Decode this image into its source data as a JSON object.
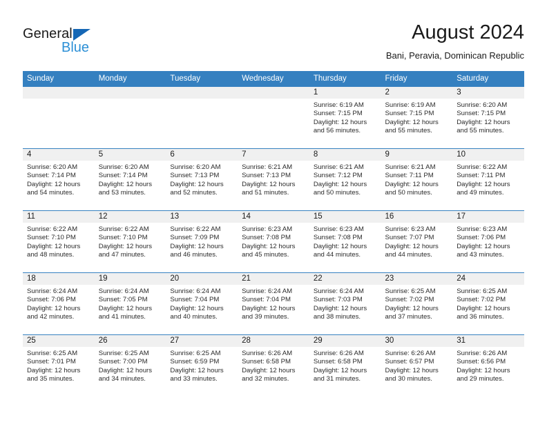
{
  "brand": {
    "name_part1": "General",
    "name_part2": "Blue",
    "triangle_color": "#1567b5",
    "blue_color": "#2b8fd6"
  },
  "header": {
    "title": "August 2024",
    "subtitle": "Bani, Peravia, Dominican Republic"
  },
  "theme": {
    "header_row_bg": "#3580c0",
    "daynum_bg": "#f0f0f0",
    "border_color": "#3580c0"
  },
  "weekday_headers": [
    "Sunday",
    "Monday",
    "Tuesday",
    "Wednesday",
    "Thursday",
    "Friday",
    "Saturday"
  ],
  "weeks": [
    [
      {
        "day": "",
        "empty": true,
        "sunrise": "",
        "sunset": "",
        "daylight_line1": "",
        "daylight_line2": ""
      },
      {
        "day": "",
        "empty": true,
        "sunrise": "",
        "sunset": "",
        "daylight_line1": "",
        "daylight_line2": ""
      },
      {
        "day": "",
        "empty": true,
        "sunrise": "",
        "sunset": "",
        "daylight_line1": "",
        "daylight_line2": ""
      },
      {
        "day": "",
        "empty": true,
        "sunrise": "",
        "sunset": "",
        "daylight_line1": "",
        "daylight_line2": ""
      },
      {
        "day": "1",
        "empty": false,
        "sunrise": "Sunrise: 6:19 AM",
        "sunset": "Sunset: 7:15 PM",
        "daylight_line1": "Daylight: 12 hours",
        "daylight_line2": "and 56 minutes."
      },
      {
        "day": "2",
        "empty": false,
        "sunrise": "Sunrise: 6:19 AM",
        "sunset": "Sunset: 7:15 PM",
        "daylight_line1": "Daylight: 12 hours",
        "daylight_line2": "and 55 minutes."
      },
      {
        "day": "3",
        "empty": false,
        "sunrise": "Sunrise: 6:20 AM",
        "sunset": "Sunset: 7:15 PM",
        "daylight_line1": "Daylight: 12 hours",
        "daylight_line2": "and 55 minutes."
      }
    ],
    [
      {
        "day": "4",
        "empty": false,
        "sunrise": "Sunrise: 6:20 AM",
        "sunset": "Sunset: 7:14 PM",
        "daylight_line1": "Daylight: 12 hours",
        "daylight_line2": "and 54 minutes."
      },
      {
        "day": "5",
        "empty": false,
        "sunrise": "Sunrise: 6:20 AM",
        "sunset": "Sunset: 7:14 PM",
        "daylight_line1": "Daylight: 12 hours",
        "daylight_line2": "and 53 minutes."
      },
      {
        "day": "6",
        "empty": false,
        "sunrise": "Sunrise: 6:20 AM",
        "sunset": "Sunset: 7:13 PM",
        "daylight_line1": "Daylight: 12 hours",
        "daylight_line2": "and 52 minutes."
      },
      {
        "day": "7",
        "empty": false,
        "sunrise": "Sunrise: 6:21 AM",
        "sunset": "Sunset: 7:13 PM",
        "daylight_line1": "Daylight: 12 hours",
        "daylight_line2": "and 51 minutes."
      },
      {
        "day": "8",
        "empty": false,
        "sunrise": "Sunrise: 6:21 AM",
        "sunset": "Sunset: 7:12 PM",
        "daylight_line1": "Daylight: 12 hours",
        "daylight_line2": "and 50 minutes."
      },
      {
        "day": "9",
        "empty": false,
        "sunrise": "Sunrise: 6:21 AM",
        "sunset": "Sunset: 7:11 PM",
        "daylight_line1": "Daylight: 12 hours",
        "daylight_line2": "and 50 minutes."
      },
      {
        "day": "10",
        "empty": false,
        "sunrise": "Sunrise: 6:22 AM",
        "sunset": "Sunset: 7:11 PM",
        "daylight_line1": "Daylight: 12 hours",
        "daylight_line2": "and 49 minutes."
      }
    ],
    [
      {
        "day": "11",
        "empty": false,
        "sunrise": "Sunrise: 6:22 AM",
        "sunset": "Sunset: 7:10 PM",
        "daylight_line1": "Daylight: 12 hours",
        "daylight_line2": "and 48 minutes."
      },
      {
        "day": "12",
        "empty": false,
        "sunrise": "Sunrise: 6:22 AM",
        "sunset": "Sunset: 7:10 PM",
        "daylight_line1": "Daylight: 12 hours",
        "daylight_line2": "and 47 minutes."
      },
      {
        "day": "13",
        "empty": false,
        "sunrise": "Sunrise: 6:22 AM",
        "sunset": "Sunset: 7:09 PM",
        "daylight_line1": "Daylight: 12 hours",
        "daylight_line2": "and 46 minutes."
      },
      {
        "day": "14",
        "empty": false,
        "sunrise": "Sunrise: 6:23 AM",
        "sunset": "Sunset: 7:08 PM",
        "daylight_line1": "Daylight: 12 hours",
        "daylight_line2": "and 45 minutes."
      },
      {
        "day": "15",
        "empty": false,
        "sunrise": "Sunrise: 6:23 AM",
        "sunset": "Sunset: 7:08 PM",
        "daylight_line1": "Daylight: 12 hours",
        "daylight_line2": "and 44 minutes."
      },
      {
        "day": "16",
        "empty": false,
        "sunrise": "Sunrise: 6:23 AM",
        "sunset": "Sunset: 7:07 PM",
        "daylight_line1": "Daylight: 12 hours",
        "daylight_line2": "and 44 minutes."
      },
      {
        "day": "17",
        "empty": false,
        "sunrise": "Sunrise: 6:23 AM",
        "sunset": "Sunset: 7:06 PM",
        "daylight_line1": "Daylight: 12 hours",
        "daylight_line2": "and 43 minutes."
      }
    ],
    [
      {
        "day": "18",
        "empty": false,
        "sunrise": "Sunrise: 6:24 AM",
        "sunset": "Sunset: 7:06 PM",
        "daylight_line1": "Daylight: 12 hours",
        "daylight_line2": "and 42 minutes."
      },
      {
        "day": "19",
        "empty": false,
        "sunrise": "Sunrise: 6:24 AM",
        "sunset": "Sunset: 7:05 PM",
        "daylight_line1": "Daylight: 12 hours",
        "daylight_line2": "and 41 minutes."
      },
      {
        "day": "20",
        "empty": false,
        "sunrise": "Sunrise: 6:24 AM",
        "sunset": "Sunset: 7:04 PM",
        "daylight_line1": "Daylight: 12 hours",
        "daylight_line2": "and 40 minutes."
      },
      {
        "day": "21",
        "empty": false,
        "sunrise": "Sunrise: 6:24 AM",
        "sunset": "Sunset: 7:04 PM",
        "daylight_line1": "Daylight: 12 hours",
        "daylight_line2": "and 39 minutes."
      },
      {
        "day": "22",
        "empty": false,
        "sunrise": "Sunrise: 6:24 AM",
        "sunset": "Sunset: 7:03 PM",
        "daylight_line1": "Daylight: 12 hours",
        "daylight_line2": "and 38 minutes."
      },
      {
        "day": "23",
        "empty": false,
        "sunrise": "Sunrise: 6:25 AM",
        "sunset": "Sunset: 7:02 PM",
        "daylight_line1": "Daylight: 12 hours",
        "daylight_line2": "and 37 minutes."
      },
      {
        "day": "24",
        "empty": false,
        "sunrise": "Sunrise: 6:25 AM",
        "sunset": "Sunset: 7:02 PM",
        "daylight_line1": "Daylight: 12 hours",
        "daylight_line2": "and 36 minutes."
      }
    ],
    [
      {
        "day": "25",
        "empty": false,
        "sunrise": "Sunrise: 6:25 AM",
        "sunset": "Sunset: 7:01 PM",
        "daylight_line1": "Daylight: 12 hours",
        "daylight_line2": "and 35 minutes."
      },
      {
        "day": "26",
        "empty": false,
        "sunrise": "Sunrise: 6:25 AM",
        "sunset": "Sunset: 7:00 PM",
        "daylight_line1": "Daylight: 12 hours",
        "daylight_line2": "and 34 minutes."
      },
      {
        "day": "27",
        "empty": false,
        "sunrise": "Sunrise: 6:25 AM",
        "sunset": "Sunset: 6:59 PM",
        "daylight_line1": "Daylight: 12 hours",
        "daylight_line2": "and 33 minutes."
      },
      {
        "day": "28",
        "empty": false,
        "sunrise": "Sunrise: 6:26 AM",
        "sunset": "Sunset: 6:58 PM",
        "daylight_line1": "Daylight: 12 hours",
        "daylight_line2": "and 32 minutes."
      },
      {
        "day": "29",
        "empty": false,
        "sunrise": "Sunrise: 6:26 AM",
        "sunset": "Sunset: 6:58 PM",
        "daylight_line1": "Daylight: 12 hours",
        "daylight_line2": "and 31 minutes."
      },
      {
        "day": "30",
        "empty": false,
        "sunrise": "Sunrise: 6:26 AM",
        "sunset": "Sunset: 6:57 PM",
        "daylight_line1": "Daylight: 12 hours",
        "daylight_line2": "and 30 minutes."
      },
      {
        "day": "31",
        "empty": false,
        "sunrise": "Sunrise: 6:26 AM",
        "sunset": "Sunset: 6:56 PM",
        "daylight_line1": "Daylight: 12 hours",
        "daylight_line2": "and 29 minutes."
      }
    ]
  ]
}
